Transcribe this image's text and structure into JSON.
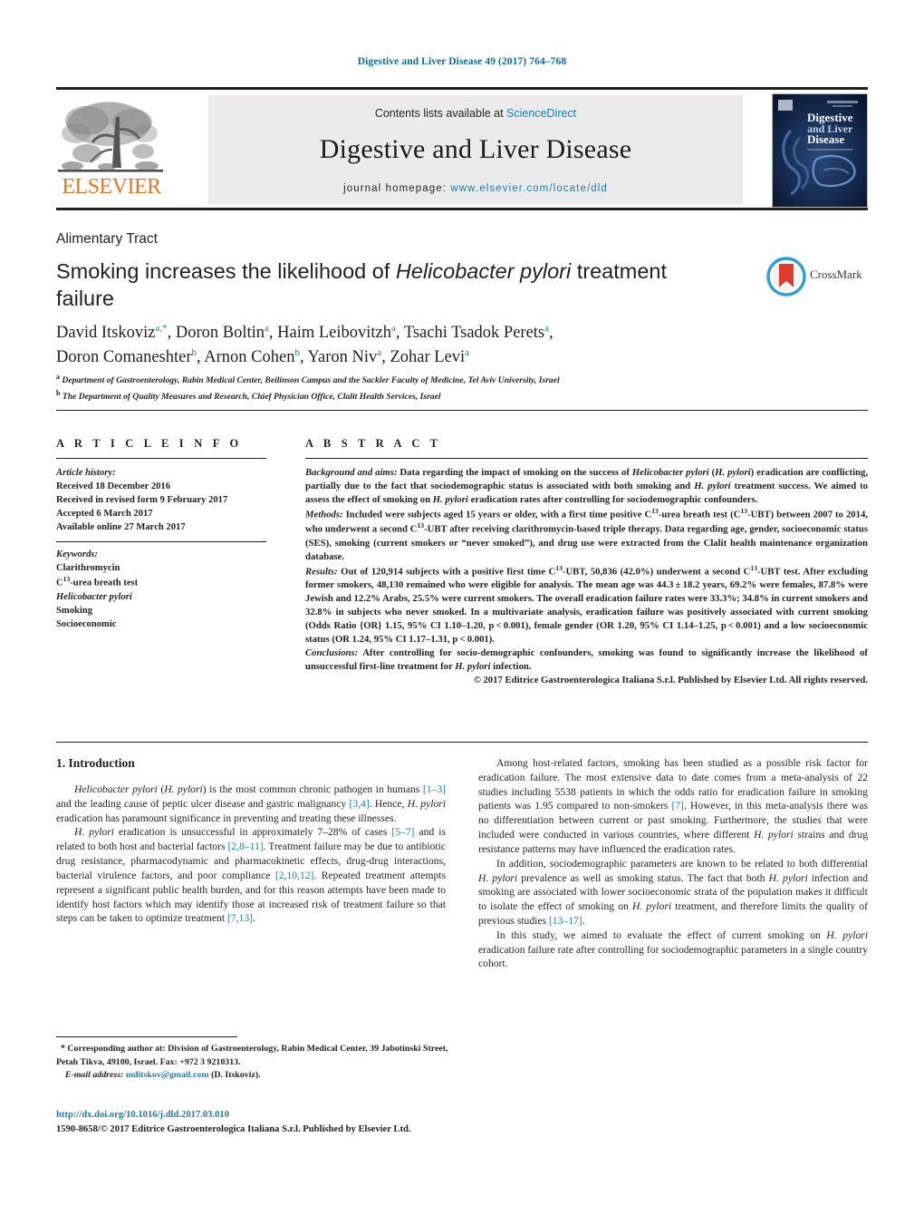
{
  "running_head": "Digestive and Liver Disease 49 (2017) 764–768",
  "masthead": {
    "contents_prefix": "Contents lists available at ",
    "sciencedirect": "ScienceDirect",
    "journal_title": "Digestive and Liver Disease",
    "homepage_label": "journal homepage:",
    "homepage_url": "www.elsevier.com/locate/dld",
    "publisher_wordmark": "ELSEVIER",
    "cover_line1": "Digestive",
    "cover_line2": "and Liver",
    "cover_line3": "Disease",
    "link_color": "#1a7bb9",
    "band_color": "#ebebeb"
  },
  "article": {
    "section_label": "Alimentary Tract",
    "title_part1": "Smoking increases the likelihood of ",
    "title_italic": "Helicobacter pylori",
    "title_part2": " treatment failure",
    "crossmark_label": "CrossMark"
  },
  "authors": {
    "line1": "David Itskoviz",
    "line1_sup": "a,*",
    "a2": "Doron Boltin",
    "a2_sup": "a",
    "a3": "Haim Leibovitzh",
    "a3_sup": "a",
    "a4": "Tsachi Tsadok Perets",
    "a4_sup": "a",
    "a5": "Doron Comaneshter",
    "a5_sup": "b",
    "a6": "Arnon Cohen",
    "a6_sup": "b",
    "a7": "Yaron Niv",
    "a7_sup": "a",
    "a8": "Zohar Levi",
    "a8_sup": "a",
    "affiliation_a": "Department of Gastroenterology, Rabin Medical Center, Beilinson Campus and the Sackler Faculty of Medicine, Tel Aviv University, Israel",
    "affiliation_b": "The Department of Quality Measures and Research, Chief Physician Office, Clalit Health Services, Israel"
  },
  "headers": {
    "article_info": "A R T I C L E   I N F O",
    "abstract": "A B S T R A C T"
  },
  "article_info": {
    "history_label": "Article history:",
    "received": "Received 18 December 2016",
    "revised": "Received in revised form 9 February 2017",
    "accepted": "Accepted 6 March 2017",
    "available": "Available online 27 March 2017",
    "keywords_label": "Keywords:",
    "keywords": [
      "Clarithromycin",
      "C13-urea breath test",
      "Helicobacter pylori",
      "Smoking",
      "Socioeconomic"
    ]
  },
  "abstract": {
    "background_label": "Background and aims:",
    "background_text": " Data regarding the impact of smoking on the success of Helicobacter pylori (H. pylori) eradication are conflicting, partially due to the fact that sociodemographic status is associated with both smoking and H. pylori treatment success. We aimed to assess the effect of smoking on H. pylori eradication rates after controlling for sociodemographic confounders.",
    "methods_label": "Methods:",
    "methods_text": " Included were subjects aged 15 years or older, with a first time positive C13-urea breath test (C13-UBT) between 2007 to 2014, who underwent a second C13-UBT after receiving clarithromycin-based triple therapy. Data regarding age, gender, socioeconomic status (SES), smoking (current smokers or “never smoked”), and drug use were extracted from the Clalit health maintenance organization database.",
    "results_label": "Results:",
    "results_text": " Out of 120,914 subjects with a positive first time C13-UBT, 50,836 (42.0%) underwent a second C13-UBT test. After excluding former smokers, 48,130 remained who were eligible for analysis. The mean age was 44.3 ± 18.2 years, 69.2% were females, 87.8% were Jewish and 12.2% Arabs, 25.5% were current smokers. The overall eradication failure rates were 33.3%; 34.8% in current smokers and 32.8% in subjects who never smoked. In a multivariate analysis, eradication failure was positively associated with current smoking (Odds Ratio {OR} 1.15, 95% CI 1.10–1.20, p < 0.001), female gender (OR 1.20, 95% CI 1.14–1.25, p < 0.001) and a low socioeconomic status (OR 1.24, 95% CI 1.17–1.31, p < 0.001).",
    "conclusions_label": "Conclusions:",
    "conclusions_text": " After controlling for socio-demographic confounders, smoking was found to significantly increase the likelihood of unsuccessful first-line treatment for H. pylori infection.",
    "copyright": "© 2017 Editrice Gastroenterologica Italiana S.r.l. Published by Elsevier Ltd. All rights reserved."
  },
  "body": {
    "intro_heading": "1.  Introduction",
    "left_p1_a": "Helicobacter pylori",
    "left_p1_b": " (H. pylori) is the most common chronic pathogen in humans ",
    "left_p1_ref1": "[1–3]",
    "left_p1_c": " and the leading cause of peptic ulcer disease and gastric malignancy ",
    "left_p1_ref2": "[3,4]",
    "left_p1_d": ". Hence, H. pylori eradication has paramount significance in preventing and treating these illnesses.",
    "left_p2_a": "H. pylori",
    "left_p2_b": " eradication is unsuccessful in approximately 7–28% of cases ",
    "left_p2_ref1": "[5–7]",
    "left_p2_c": " and is related to both host and bacterial factors ",
    "left_p2_ref2": "[2,8–11]",
    "left_p2_d": ". Treatment failure may be due to antibiotic drug resistance, pharmacodynamic and pharmacokinetic effects, drug-drug interactions, bacterial virulence factors, and poor compliance ",
    "left_p2_ref3": "[2,10,12]",
    "left_p2_e": ". Repeated treatment attempts represent a significant public health burden, and for this reason attempts have been made to identify host factors which may identify those at increased risk of treatment failure so that steps can be taken to optimize treatment ",
    "left_p2_ref4": "[7,13]",
    "left_p2_f": ".",
    "right_p1_a": "Among host-related factors, smoking has been studied as a possible risk factor for eradication failure. The most extensive data to date comes from a meta-analysis of 22 studies including 5538 patients in which the odds ratio for eradication failure in smoking patients was 1.95 compared to non-smokers ",
    "right_p1_ref": "[7]",
    "right_p1_b": ". However, in this meta-analysis there was no differentiation between current or past smoking. Furthermore, the studies that were included were conducted in various countries, where different H. pylori strains and drug resistance patterns may have influenced the eradication rates.",
    "right_p2_a": "In addition, sociodemographic parameters are known to be related to both differential H. pylori prevalence as well as smoking status. The fact that both H. pylori infection and smoking are associated with lower socioeconomic strata of the population makes it difficult to isolate the effect of smoking on H. pylori treatment, and therefore limits the quality of previous studies ",
    "right_p2_ref": "[13–17]",
    "right_p2_b": ".",
    "right_p3": "In this study, we aimed to evaluate the effect of current smoking on H. pylori eradication failure rate after controlling for sociodemographic parameters in a single country cohort."
  },
  "footnote": {
    "star": "*",
    "corresponding_text": " Corresponding author at: Division of Gastroenterology, Rabin Medical Center, 39 Jabotinski Street, Petah Tikva, 49100, Israel. Fax: +972 3 9210313.",
    "email_label": "E-mail address:",
    "email": "mditskov@gmail.com",
    "email_suffix": " (D. Itskoviz)."
  },
  "doi_block": {
    "doi_url": "http://dx.doi.org/10.1016/j.dld.2017.03.010",
    "issn_line": "1590-8658/© 2017 Editrice Gastroenterologica Italiana S.r.l. Published by Elsevier Ltd."
  }
}
